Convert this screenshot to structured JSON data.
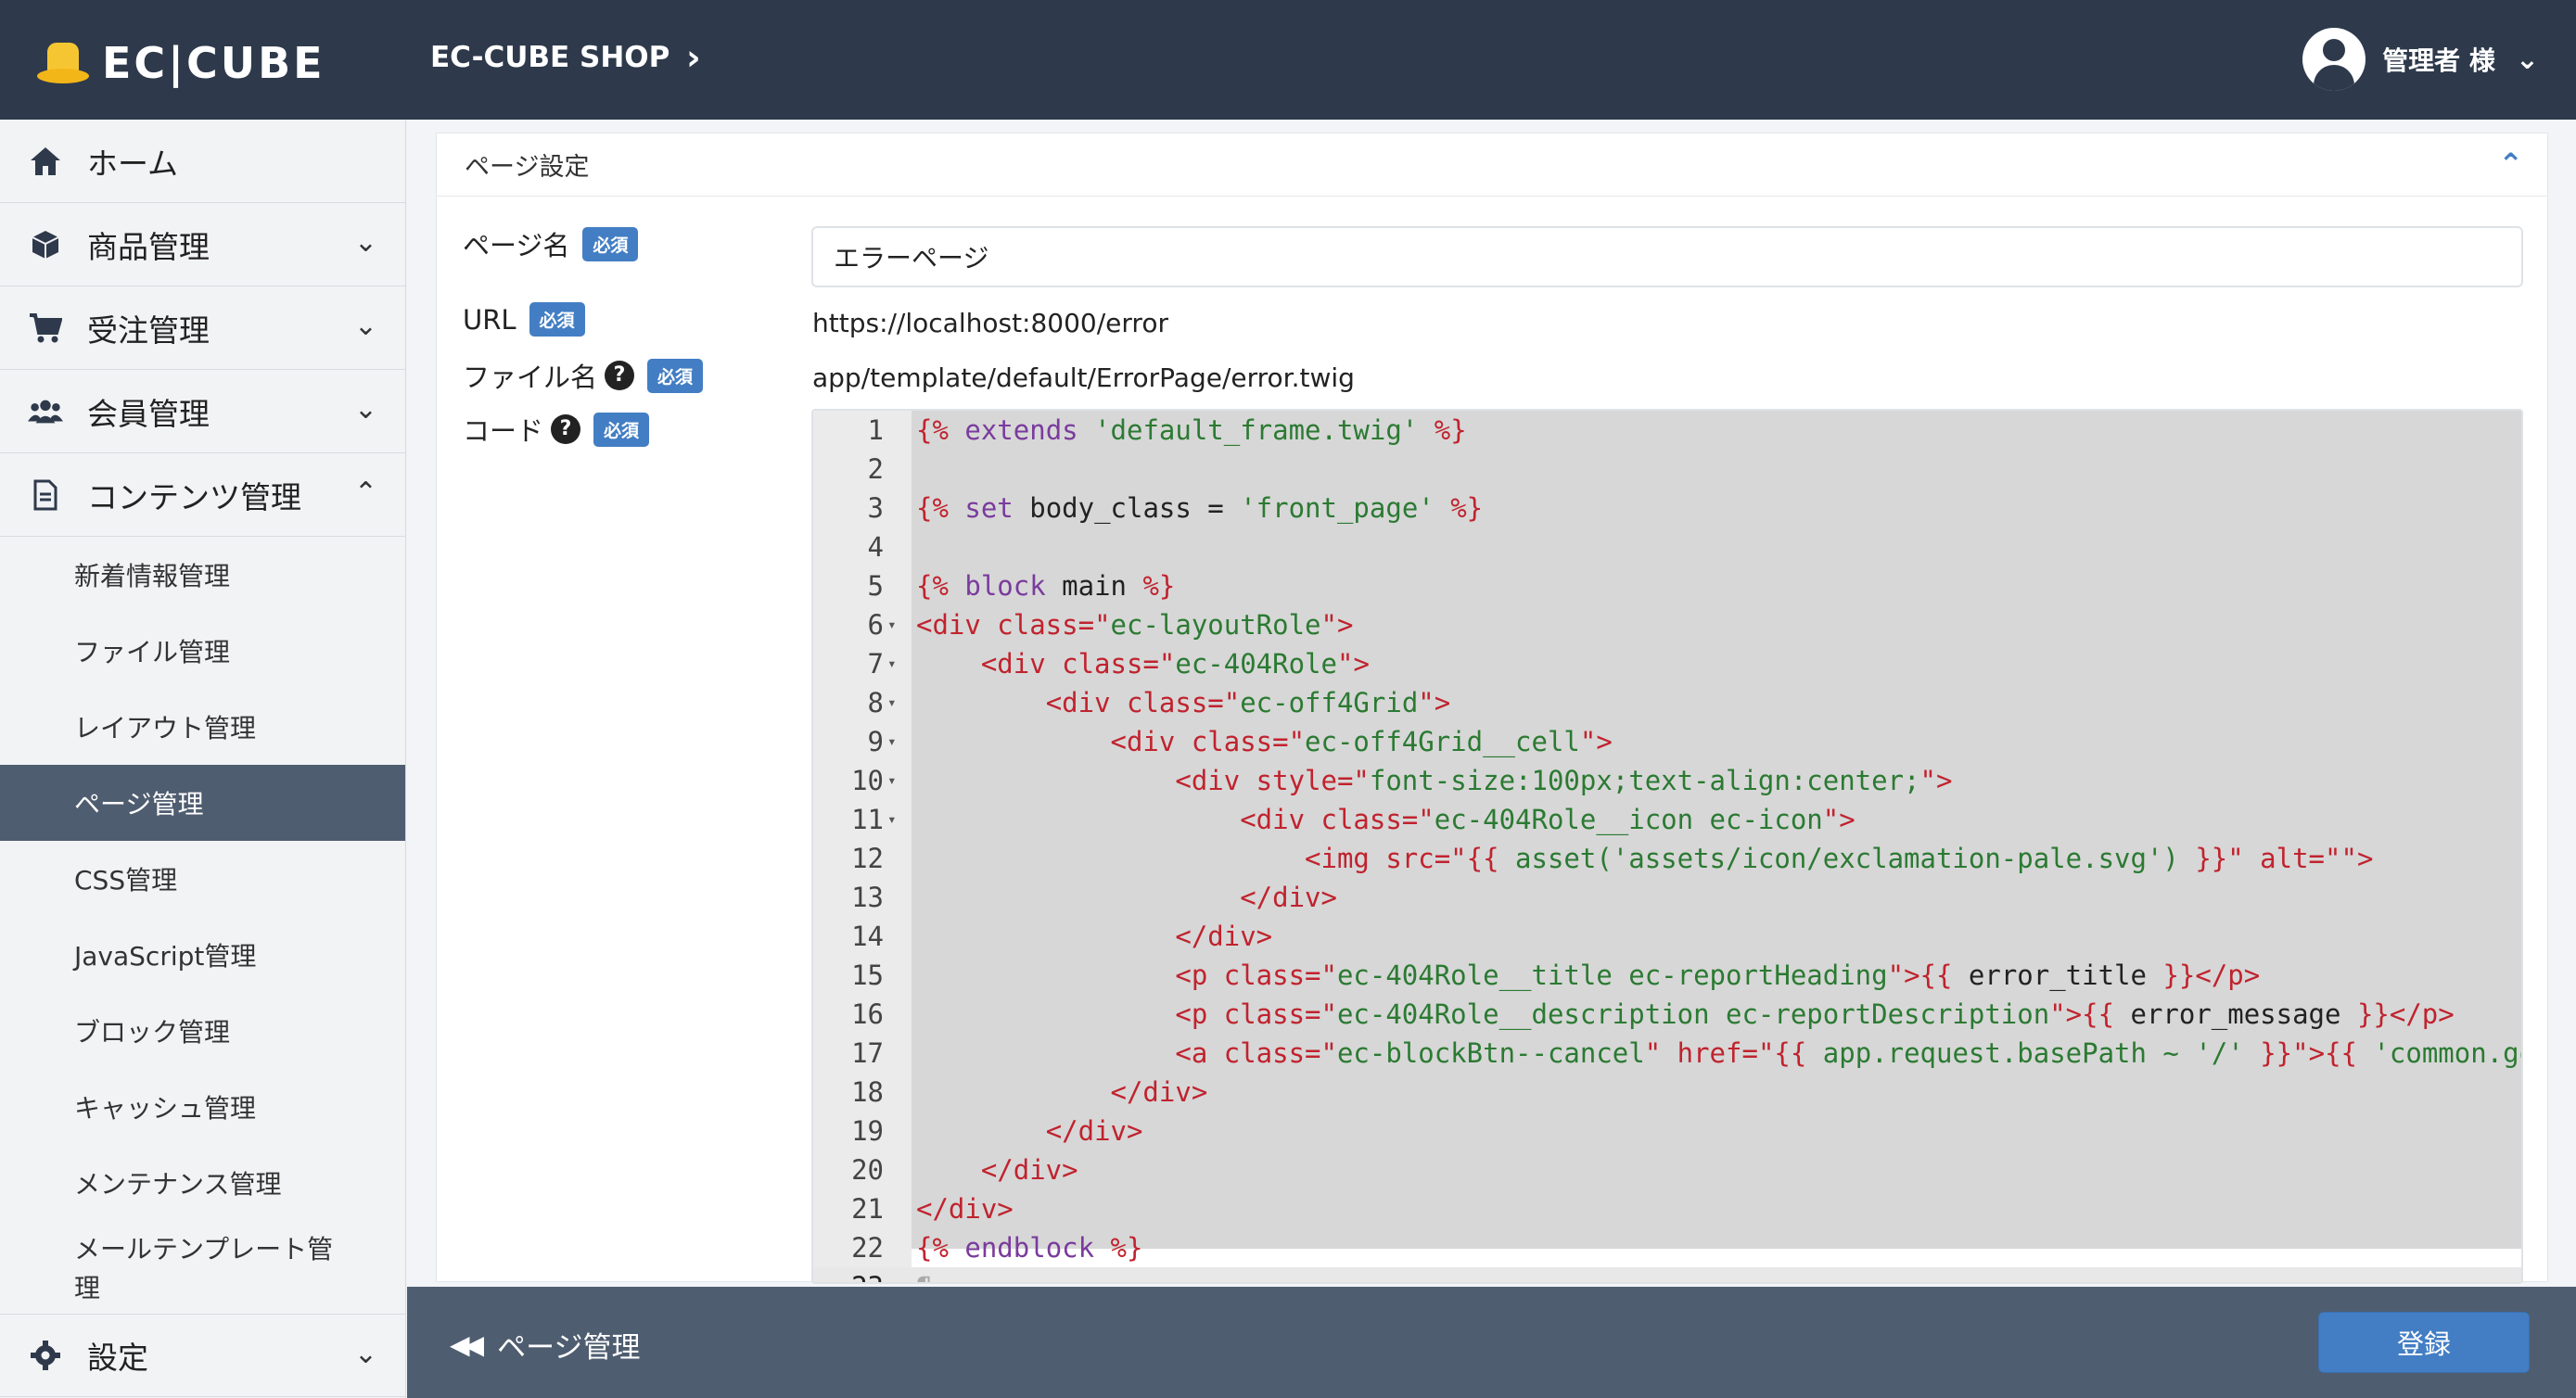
{
  "header": {
    "logo_text": "EC|CUBE",
    "shop_name": "EC-CUBE SHOP",
    "user_name": "管理者 様"
  },
  "sidebar": {
    "main_items": [
      {
        "label": "ホーム",
        "icon": "home-icon"
      },
      {
        "label": "商品管理",
        "icon": "cube-icon"
      },
      {
        "label": "受注管理",
        "icon": "cart-icon"
      },
      {
        "label": "会員管理",
        "icon": "users-icon"
      },
      {
        "label": "コンテンツ管理",
        "icon": "file-icon"
      }
    ],
    "content_sub_items": [
      {
        "label": "新着情報管理"
      },
      {
        "label": "ファイル管理"
      },
      {
        "label": "レイアウト管理"
      },
      {
        "label": "ページ管理",
        "active": true
      },
      {
        "label": "CSS管理"
      },
      {
        "label": "JavaScript管理"
      },
      {
        "label": "ブロック管理"
      },
      {
        "label": "キャッシュ管理"
      },
      {
        "label": "メンテナンス管理"
      },
      {
        "label": "メールテンプレート管理"
      }
    ],
    "settings_label": "設定"
  },
  "card": {
    "title": "ページ設定",
    "required_badge": "必須",
    "page_name_label": "ページ名",
    "page_name_value": "エラーページ",
    "url_label": "URL",
    "url_value": "https://localhost:8000/error",
    "file_name_label": "ファイル名",
    "file_name_value": "app/template/default/ErrorPage/error.twig",
    "code_label": "コード",
    "help_glyph": "?"
  },
  "editor": {
    "lines": [
      "{% extends 'default_frame.twig' %}",
      "",
      "{% set body_class = 'front_page' %}",
      "",
      "{% block main %}",
      "<div class=\"ec-layoutRole\">",
      "    <div class=\"ec-404Role\">",
      "        <div class=\"ec-off4Grid\">",
      "            <div class=\"ec-off4Grid__cell\">",
      "                <div style=\"font-size:100px;text-align:center;\">",
      "                    <div class=\"ec-404Role__icon ec-icon\">",
      "                        <img src=\"{{ asset('assets/icon/exclamation-pale.svg') }}\" alt=\"\">",
      "                    </div>",
      "                </div>",
      "                <p class=\"ec-404Role__title ec-reportHeading\">{{ error_title }}</p>",
      "                <p class=\"ec-404Role__description ec-reportDescription\">{{ error_message }}</p>",
      "                <a class=\"ec-blockBtn--cancel\" href=\"{{ app.request.basePath ~ '/' }}\">{{ 'common.go_to",
      "            </div>",
      "        </div>",
      "    </div>",
      "</div>",
      "{% endblock %}",
      "¶"
    ],
    "fold_lines": [
      6,
      7,
      8,
      9,
      10,
      11
    ]
  },
  "footer": {
    "back_label": "ページ管理",
    "submit_label": "登録"
  },
  "colors": {
    "header_bg": "#2e3a4b",
    "accent": "#437ec4",
    "active_nav": "#4f5d70"
  }
}
